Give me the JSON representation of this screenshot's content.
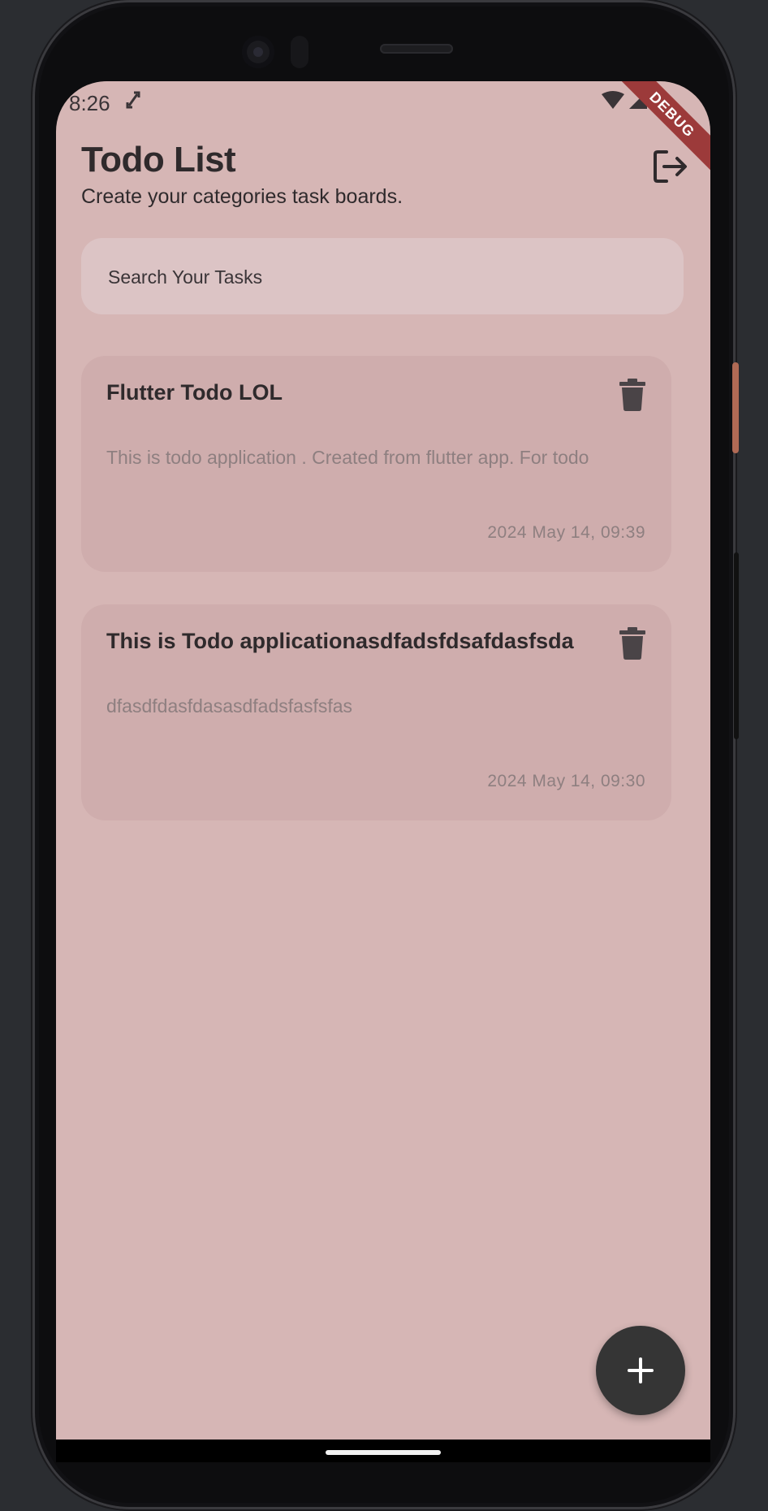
{
  "status_bar": {
    "time": "8:26",
    "debug_label": "DEBUG"
  },
  "header": {
    "title": "Todo List",
    "subtitle": "Create your categories task boards."
  },
  "search": {
    "placeholder": "Search Your Tasks"
  },
  "tasks": [
    {
      "title": "Flutter Todo LOL",
      "description": "This is todo application . Created from flutter app. For todo",
      "date": "2024 May 14, 09:39"
    },
    {
      "title": "This is Todo applicationasdfadsfdsafdasfsda",
      "description": "dfasdfdasfdasasdfadsfasfsfas",
      "date": "2024 May 14, 09:30"
    }
  ],
  "icons": {
    "logout": "logout-icon",
    "delete": "trash-icon",
    "add": "plus-icon"
  },
  "colors": {
    "background": "#d6b6b5",
    "card": "#cfadad",
    "search": "#dcc4c5",
    "fab": "#353535",
    "text": "#2f2a2c",
    "muted_text": "#8e7f80",
    "debug_ribbon": "#9c3a3a"
  }
}
